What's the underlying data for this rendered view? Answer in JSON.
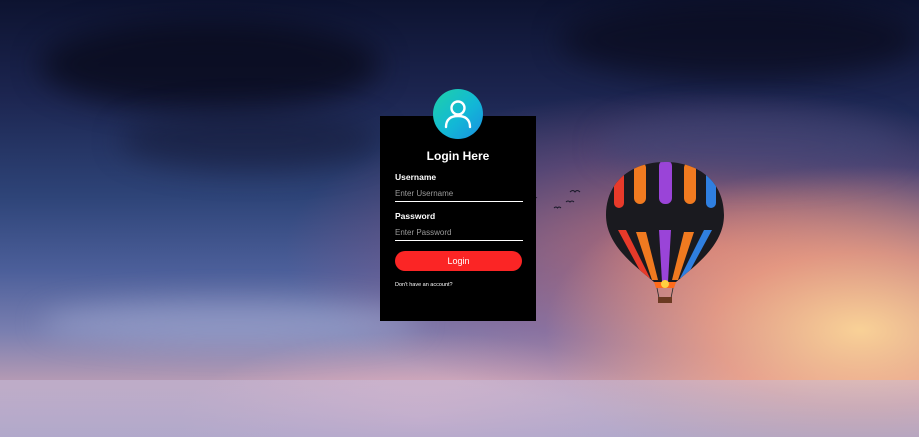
{
  "login": {
    "title": "Login Here",
    "username_label": "Username",
    "username_placeholder": "Enter Username",
    "password_label": "Password",
    "password_placeholder": "Enter Password",
    "button_label": "Login",
    "signup_link": "Don't have an account?"
  },
  "icons": {
    "avatar": "user-icon",
    "balloon": "hot-air-balloon",
    "birds": "birds"
  },
  "colors": {
    "card_background": "#000000",
    "button": "#fb2525",
    "avatar_gradient_start": "#1fd1a7",
    "avatar_gradient_end": "#1a8fe0"
  }
}
